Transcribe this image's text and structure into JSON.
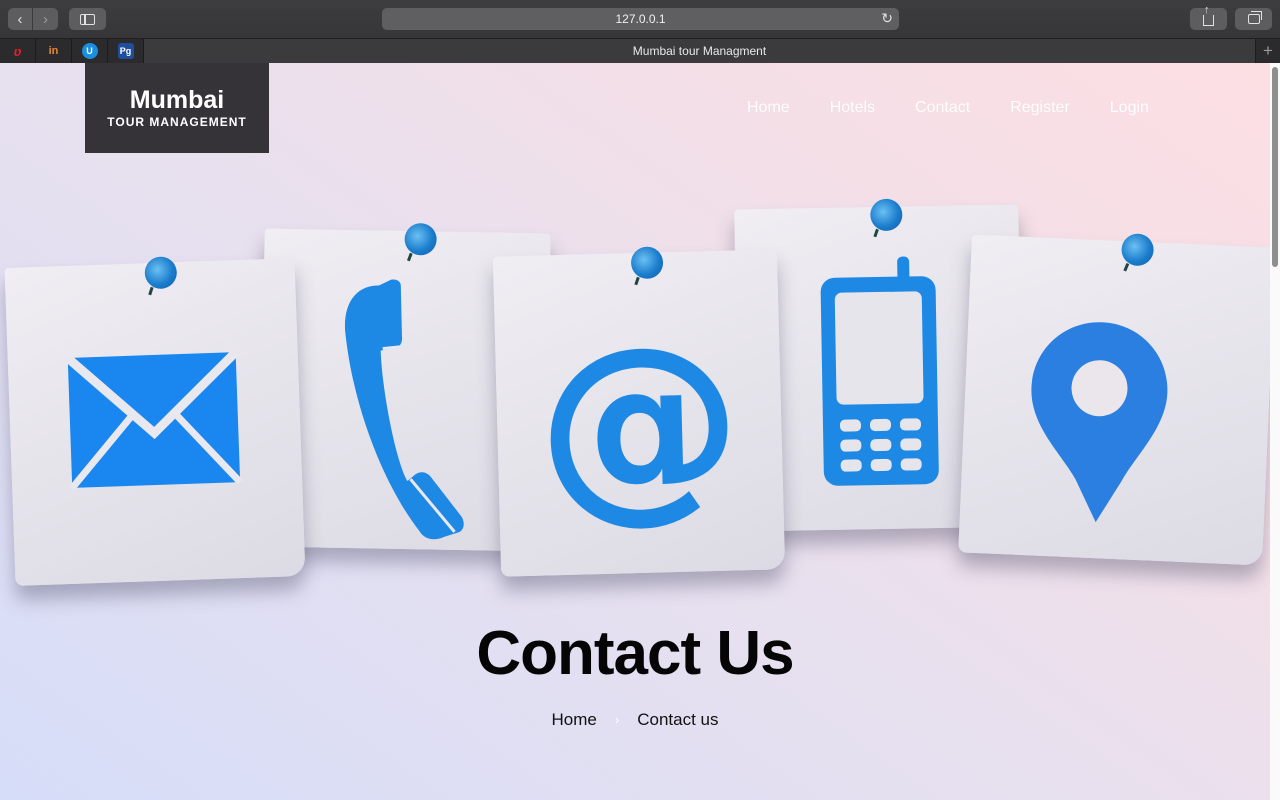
{
  "browser": {
    "url": "127.0.0.1",
    "tab_title": "Mumbai tour Managment",
    "icons": [
      "back-icon",
      "forward-icon",
      "sidebar-icon",
      "reload-icon",
      "share-icon",
      "tabs-overview-icon",
      "new-tab-icon"
    ]
  },
  "site": {
    "logo_title": "Mumbai",
    "logo_subtitle": "TOUR MANAGEMENT",
    "nav": [
      "Home",
      "Hotels",
      "Contact",
      "Register",
      "Login"
    ]
  },
  "hero": {
    "icons": [
      "envelope-icon",
      "phone-icon",
      "at-sign-icon",
      "mobile-phone-icon",
      "location-pin-icon"
    ],
    "accent_color": "#1e88e5"
  },
  "header": {
    "title": "Contact Us",
    "breadcrumb": [
      "Home",
      "Contact us"
    ]
  }
}
